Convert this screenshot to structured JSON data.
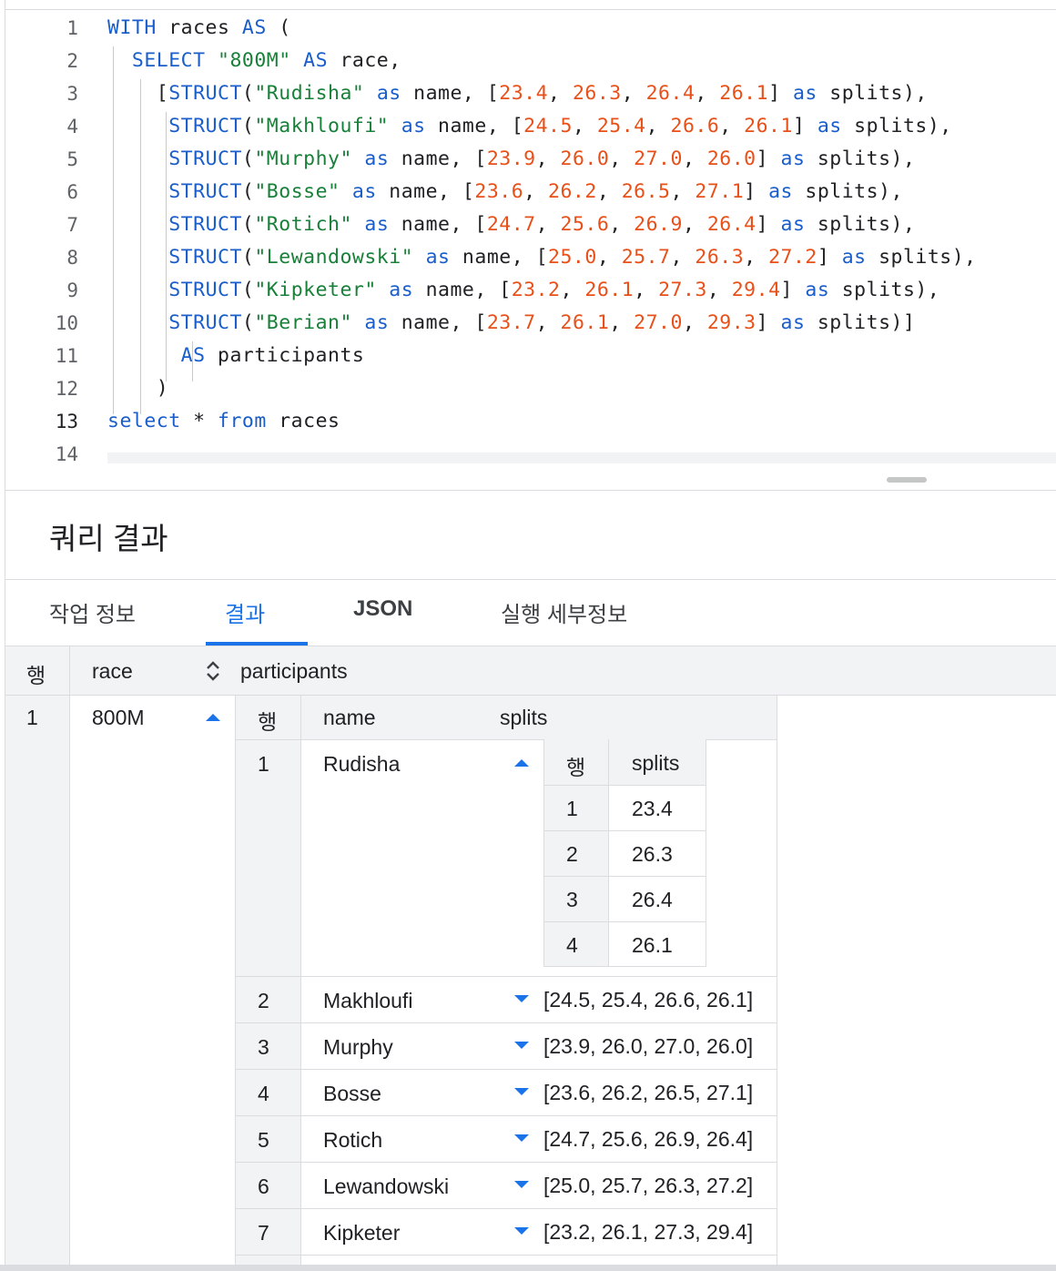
{
  "editor": {
    "lines": [
      {
        "n": "1",
        "tokens": [
          [
            "kw",
            "WITH"
          ],
          [
            "t",
            " races "
          ],
          [
            "kw",
            "AS"
          ],
          [
            "t",
            " ("
          ]
        ]
      },
      {
        "n": "2",
        "tokens": [
          [
            "t",
            "  "
          ],
          [
            "kw",
            "SELECT"
          ],
          [
            "t",
            " "
          ],
          [
            "str",
            "\"800M\""
          ],
          [
            "t",
            " "
          ],
          [
            "kw",
            "AS"
          ],
          [
            "t",
            " race,"
          ]
        ]
      },
      {
        "n": "3",
        "tokens": [
          [
            "t",
            "    ["
          ],
          [
            "kw",
            "STRUCT"
          ],
          [
            "t",
            "("
          ],
          [
            "str",
            "\"Rudisha\""
          ],
          [
            "t",
            " "
          ],
          [
            "kw",
            "as"
          ],
          [
            "t",
            " name, ["
          ],
          [
            "num",
            "23.4"
          ],
          [
            "t",
            ", "
          ],
          [
            "num",
            "26.3"
          ],
          [
            "t",
            ", "
          ],
          [
            "num",
            "26.4"
          ],
          [
            "t",
            ", "
          ],
          [
            "num",
            "26.1"
          ],
          [
            "t",
            "] "
          ],
          [
            "kw",
            "as"
          ],
          [
            "t",
            " splits),"
          ]
        ]
      },
      {
        "n": "4",
        "tokens": [
          [
            "t",
            "     "
          ],
          [
            "kw",
            "STRUCT"
          ],
          [
            "t",
            "("
          ],
          [
            "str",
            "\"Makhloufi\""
          ],
          [
            "t",
            " "
          ],
          [
            "kw",
            "as"
          ],
          [
            "t",
            " name, ["
          ],
          [
            "num",
            "24.5"
          ],
          [
            "t",
            ", "
          ],
          [
            "num",
            "25.4"
          ],
          [
            "t",
            ", "
          ],
          [
            "num",
            "26.6"
          ],
          [
            "t",
            ", "
          ],
          [
            "num",
            "26.1"
          ],
          [
            "t",
            "] "
          ],
          [
            "kw",
            "as"
          ],
          [
            "t",
            " splits),"
          ]
        ]
      },
      {
        "n": "5",
        "tokens": [
          [
            "t",
            "     "
          ],
          [
            "kw",
            "STRUCT"
          ],
          [
            "t",
            "("
          ],
          [
            "str",
            "\"Murphy\""
          ],
          [
            "t",
            " "
          ],
          [
            "kw",
            "as"
          ],
          [
            "t",
            " name, ["
          ],
          [
            "num",
            "23.9"
          ],
          [
            "t",
            ", "
          ],
          [
            "num",
            "26.0"
          ],
          [
            "t",
            ", "
          ],
          [
            "num",
            "27.0"
          ],
          [
            "t",
            ", "
          ],
          [
            "num",
            "26.0"
          ],
          [
            "t",
            "] "
          ],
          [
            "kw",
            "as"
          ],
          [
            "t",
            " splits),"
          ]
        ]
      },
      {
        "n": "6",
        "tokens": [
          [
            "t",
            "     "
          ],
          [
            "kw",
            "STRUCT"
          ],
          [
            "t",
            "("
          ],
          [
            "str",
            "\"Bosse\""
          ],
          [
            "t",
            " "
          ],
          [
            "kw",
            "as"
          ],
          [
            "t",
            " name, ["
          ],
          [
            "num",
            "23.6"
          ],
          [
            "t",
            ", "
          ],
          [
            "num",
            "26.2"
          ],
          [
            "t",
            ", "
          ],
          [
            "num",
            "26.5"
          ],
          [
            "t",
            ", "
          ],
          [
            "num",
            "27.1"
          ],
          [
            "t",
            "] "
          ],
          [
            "kw",
            "as"
          ],
          [
            "t",
            " splits),"
          ]
        ]
      },
      {
        "n": "7",
        "tokens": [
          [
            "t",
            "     "
          ],
          [
            "kw",
            "STRUCT"
          ],
          [
            "t",
            "("
          ],
          [
            "str",
            "\"Rotich\""
          ],
          [
            "t",
            " "
          ],
          [
            "kw",
            "as"
          ],
          [
            "t",
            " name, ["
          ],
          [
            "num",
            "24.7"
          ],
          [
            "t",
            ", "
          ],
          [
            "num",
            "25.6"
          ],
          [
            "t",
            ", "
          ],
          [
            "num",
            "26.9"
          ],
          [
            "t",
            ", "
          ],
          [
            "num",
            "26.4"
          ],
          [
            "t",
            "] "
          ],
          [
            "kw",
            "as"
          ],
          [
            "t",
            " splits),"
          ]
        ]
      },
      {
        "n": "8",
        "tokens": [
          [
            "t",
            "     "
          ],
          [
            "kw",
            "STRUCT"
          ],
          [
            "t",
            "("
          ],
          [
            "str",
            "\"Lewandowski\""
          ],
          [
            "t",
            " "
          ],
          [
            "kw",
            "as"
          ],
          [
            "t",
            " name, ["
          ],
          [
            "num",
            "25.0"
          ],
          [
            "t",
            ", "
          ],
          [
            "num",
            "25.7"
          ],
          [
            "t",
            ", "
          ],
          [
            "num",
            "26.3"
          ],
          [
            "t",
            ", "
          ],
          [
            "num",
            "27.2"
          ],
          [
            "t",
            "] "
          ],
          [
            "kw",
            "as"
          ],
          [
            "t",
            " splits),"
          ]
        ]
      },
      {
        "n": "9",
        "tokens": [
          [
            "t",
            "     "
          ],
          [
            "kw",
            "STRUCT"
          ],
          [
            "t",
            "("
          ],
          [
            "str",
            "\"Kipketer\""
          ],
          [
            "t",
            " "
          ],
          [
            "kw",
            "as"
          ],
          [
            "t",
            " name, ["
          ],
          [
            "num",
            "23.2"
          ],
          [
            "t",
            ", "
          ],
          [
            "num",
            "26.1"
          ],
          [
            "t",
            ", "
          ],
          [
            "num",
            "27.3"
          ],
          [
            "t",
            ", "
          ],
          [
            "num",
            "29.4"
          ],
          [
            "t",
            "] "
          ],
          [
            "kw",
            "as"
          ],
          [
            "t",
            " splits),"
          ]
        ]
      },
      {
        "n": "10",
        "tokens": [
          [
            "t",
            "     "
          ],
          [
            "kw",
            "STRUCT"
          ],
          [
            "t",
            "("
          ],
          [
            "str",
            "\"Berian\""
          ],
          [
            "t",
            " "
          ],
          [
            "kw",
            "as"
          ],
          [
            "t",
            " name, ["
          ],
          [
            "num",
            "23.7"
          ],
          [
            "t",
            ", "
          ],
          [
            "num",
            "26.1"
          ],
          [
            "t",
            ", "
          ],
          [
            "num",
            "27.0"
          ],
          [
            "t",
            ", "
          ],
          [
            "num",
            "29.3"
          ],
          [
            "t",
            "] "
          ],
          [
            "kw",
            "as"
          ],
          [
            "t",
            " splits)]"
          ]
        ]
      },
      {
        "n": "11",
        "tokens": [
          [
            "t",
            "      "
          ],
          [
            "kw",
            "AS"
          ],
          [
            "t",
            " participants"
          ]
        ]
      },
      {
        "n": "12",
        "tokens": [
          [
            "t",
            "    )"
          ]
        ]
      },
      {
        "n": "13",
        "tokens": [
          [
            "kw",
            "select"
          ],
          [
            "t",
            " * "
          ],
          [
            "kw",
            "from"
          ],
          [
            "t",
            " races"
          ]
        ]
      },
      {
        "n": "14",
        "tokens": []
      }
    ]
  },
  "results": {
    "title": "쿼리 결과",
    "tabs": [
      {
        "label": "작업 정보",
        "active": false
      },
      {
        "label": "결과",
        "active": true
      },
      {
        "label": "JSON",
        "active": false
      },
      {
        "label": "실행 세부정보",
        "active": false
      }
    ],
    "columns": {
      "row": "행",
      "race": "race",
      "participants": "participants"
    },
    "nested_columns": {
      "row": "행",
      "name": "name",
      "splits": "splits"
    },
    "splits_columns": {
      "row": "행",
      "splits": "splits"
    },
    "row": {
      "num": "1",
      "race": "800M"
    },
    "participants": [
      {
        "num": "1",
        "name": "Rudisha",
        "expanded": true,
        "splits": [
          {
            "num": "1",
            "value": "23.4"
          },
          {
            "num": "2",
            "value": "26.3"
          },
          {
            "num": "3",
            "value": "26.4"
          },
          {
            "num": "4",
            "value": "26.1"
          }
        ]
      },
      {
        "num": "2",
        "name": "Makhloufi",
        "splits_text": "[24.5, 25.4, 26.6, 26.1]"
      },
      {
        "num": "3",
        "name": "Murphy",
        "splits_text": "[23.9, 26.0, 27.0, 26.0]"
      },
      {
        "num": "4",
        "name": "Bosse",
        "splits_text": "[23.6, 26.2, 26.5, 27.1]"
      },
      {
        "num": "5",
        "name": "Rotich",
        "splits_text": "[24.7, 25.6, 26.9, 26.4]"
      },
      {
        "num": "6",
        "name": "Lewandowski",
        "splits_text": "[25.0, 25.7, 26.3, 27.2]"
      },
      {
        "num": "7",
        "name": "Kipketer",
        "splits_text": "[23.2, 26.1, 27.3, 29.4]"
      }
    ]
  },
  "icons": {
    "sort": "sort-unfold-icon",
    "expand": "triangle-up-icon",
    "collapse": "triangle-down-icon"
  },
  "colors": {
    "keyword": "#1a5ecb",
    "string": "#188038",
    "number": "#e8501a",
    "accent": "#1a73e8"
  }
}
